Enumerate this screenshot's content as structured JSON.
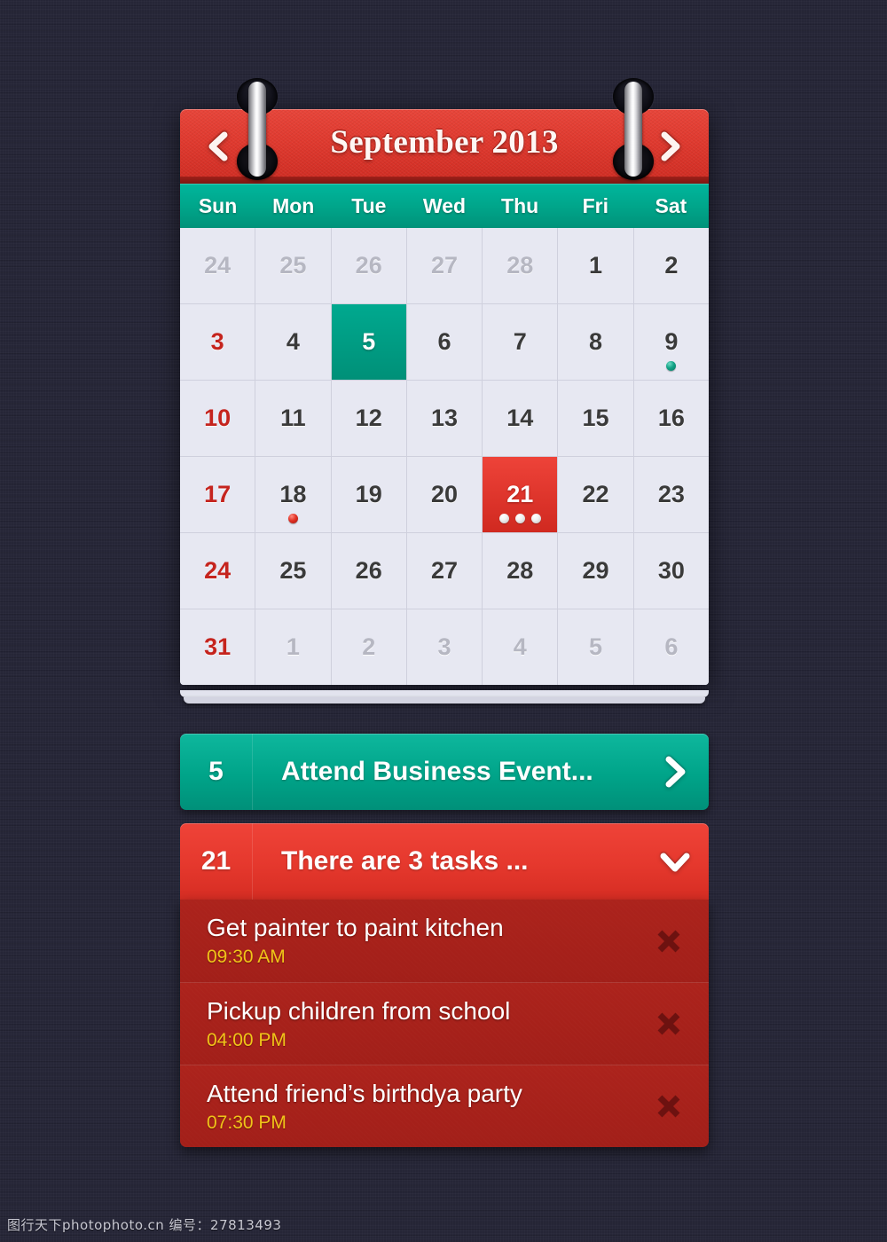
{
  "background": {
    "color": "#252536"
  },
  "calendar": {
    "title": "September 2013",
    "prev_label": "‹",
    "next_label": "›",
    "weekdays": [
      "Sun",
      "Mon",
      "Tue",
      "Wed",
      "Thu",
      "Fri",
      "Sat"
    ],
    "colors": {
      "header_red": "#e0392e",
      "weekday_teal": "#00a489",
      "cell_bg": "#e7e8f2",
      "selected_green": "#00a98f",
      "selected_red": "#e5382d",
      "sunday_text": "#c5241e",
      "other_month_text": "#b6b7c2"
    },
    "weeks": [
      [
        {
          "num": "24",
          "state": "other",
          "sunday": true,
          "dots": 0,
          "dot_color": ""
        },
        {
          "num": "25",
          "state": "other",
          "sunday": false,
          "dots": 0,
          "dot_color": ""
        },
        {
          "num": "26",
          "state": "other",
          "sunday": false,
          "dots": 0,
          "dot_color": ""
        },
        {
          "num": "27",
          "state": "other",
          "sunday": false,
          "dots": 0,
          "dot_color": ""
        },
        {
          "num": "28",
          "state": "other",
          "sunday": false,
          "dots": 0,
          "dot_color": ""
        },
        {
          "num": "1",
          "state": "normal",
          "sunday": false,
          "dots": 0,
          "dot_color": ""
        },
        {
          "num": "2",
          "state": "normal",
          "sunday": false,
          "dots": 0,
          "dot_color": ""
        }
      ],
      [
        {
          "num": "3",
          "state": "normal",
          "sunday": true,
          "dots": 0,
          "dot_color": ""
        },
        {
          "num": "4",
          "state": "normal",
          "sunday": false,
          "dots": 0,
          "dot_color": ""
        },
        {
          "num": "5",
          "state": "selected-green",
          "sunday": false,
          "dots": 0,
          "dot_color": ""
        },
        {
          "num": "6",
          "state": "normal",
          "sunday": false,
          "dots": 0,
          "dot_color": ""
        },
        {
          "num": "7",
          "state": "normal",
          "sunday": false,
          "dots": 0,
          "dot_color": ""
        },
        {
          "num": "8",
          "state": "normal",
          "sunday": false,
          "dots": 0,
          "dot_color": ""
        },
        {
          "num": "9",
          "state": "normal",
          "sunday": false,
          "dots": 1,
          "dot_color": "teal"
        }
      ],
      [
        {
          "num": "10",
          "state": "normal",
          "sunday": true,
          "dots": 0,
          "dot_color": ""
        },
        {
          "num": "11",
          "state": "normal",
          "sunday": false,
          "dots": 0,
          "dot_color": ""
        },
        {
          "num": "12",
          "state": "normal",
          "sunday": false,
          "dots": 0,
          "dot_color": ""
        },
        {
          "num": "13",
          "state": "normal",
          "sunday": false,
          "dots": 0,
          "dot_color": ""
        },
        {
          "num": "14",
          "state": "normal",
          "sunday": false,
          "dots": 0,
          "dot_color": ""
        },
        {
          "num": "15",
          "state": "normal",
          "sunday": false,
          "dots": 0,
          "dot_color": ""
        },
        {
          "num": "16",
          "state": "normal",
          "sunday": false,
          "dots": 0,
          "dot_color": ""
        }
      ],
      [
        {
          "num": "17",
          "state": "normal",
          "sunday": true,
          "dots": 0,
          "dot_color": ""
        },
        {
          "num": "18",
          "state": "normal",
          "sunday": false,
          "dots": 1,
          "dot_color": "red"
        },
        {
          "num": "19",
          "state": "normal",
          "sunday": false,
          "dots": 0,
          "dot_color": ""
        },
        {
          "num": "20",
          "state": "normal",
          "sunday": false,
          "dots": 0,
          "dot_color": ""
        },
        {
          "num": "21",
          "state": "selected-red",
          "sunday": false,
          "dots": 3,
          "dot_color": "white"
        },
        {
          "num": "22",
          "state": "normal",
          "sunday": false,
          "dots": 0,
          "dot_color": ""
        },
        {
          "num": "23",
          "state": "normal",
          "sunday": false,
          "dots": 0,
          "dot_color": ""
        }
      ],
      [
        {
          "num": "24",
          "state": "normal",
          "sunday": true,
          "dots": 0,
          "dot_color": ""
        },
        {
          "num": "25",
          "state": "normal",
          "sunday": false,
          "dots": 0,
          "dot_color": ""
        },
        {
          "num": "26",
          "state": "normal",
          "sunday": false,
          "dots": 0,
          "dot_color": ""
        },
        {
          "num": "27",
          "state": "normal",
          "sunday": false,
          "dots": 0,
          "dot_color": ""
        },
        {
          "num": "28",
          "state": "normal",
          "sunday": false,
          "dots": 0,
          "dot_color": ""
        },
        {
          "num": "29",
          "state": "normal",
          "sunday": false,
          "dots": 0,
          "dot_color": ""
        },
        {
          "num": "30",
          "state": "normal",
          "sunday": false,
          "dots": 0,
          "dot_color": ""
        }
      ],
      [
        {
          "num": "31",
          "state": "normal",
          "sunday": true,
          "dots": 0,
          "dot_color": ""
        },
        {
          "num": "1",
          "state": "other",
          "sunday": false,
          "dots": 0,
          "dot_color": ""
        },
        {
          "num": "2",
          "state": "other",
          "sunday": false,
          "dots": 0,
          "dot_color": ""
        },
        {
          "num": "3",
          "state": "other",
          "sunday": false,
          "dots": 0,
          "dot_color": ""
        },
        {
          "num": "4",
          "state": "other",
          "sunday": false,
          "dots": 0,
          "dot_color": ""
        },
        {
          "num": "5",
          "state": "other",
          "sunday": false,
          "dots": 0,
          "dot_color": ""
        },
        {
          "num": "6",
          "state": "other",
          "sunday": false,
          "dots": 0,
          "dot_color": ""
        }
      ]
    ]
  },
  "events": [
    {
      "day": "5",
      "title": "Attend Business Event...",
      "color": "green",
      "chevron": "chevron-right-icon",
      "expanded": false
    },
    {
      "day": "21",
      "title": "There are 3 tasks ...",
      "color": "red",
      "chevron": "chevron-down-icon",
      "expanded": true
    }
  ],
  "tasks": [
    {
      "name": "Get painter to paint kitchen",
      "time": "09:30 AM",
      "delete_label": "✕"
    },
    {
      "name": "Pickup children from school",
      "time": "04:00 PM",
      "delete_label": "✕"
    },
    {
      "name": "Attend friend’s birthdya party",
      "time": "07:30 PM",
      "delete_label": "✕"
    }
  ],
  "watermark": {
    "text": "图行天下photophoto.cn  编号：27813493"
  }
}
